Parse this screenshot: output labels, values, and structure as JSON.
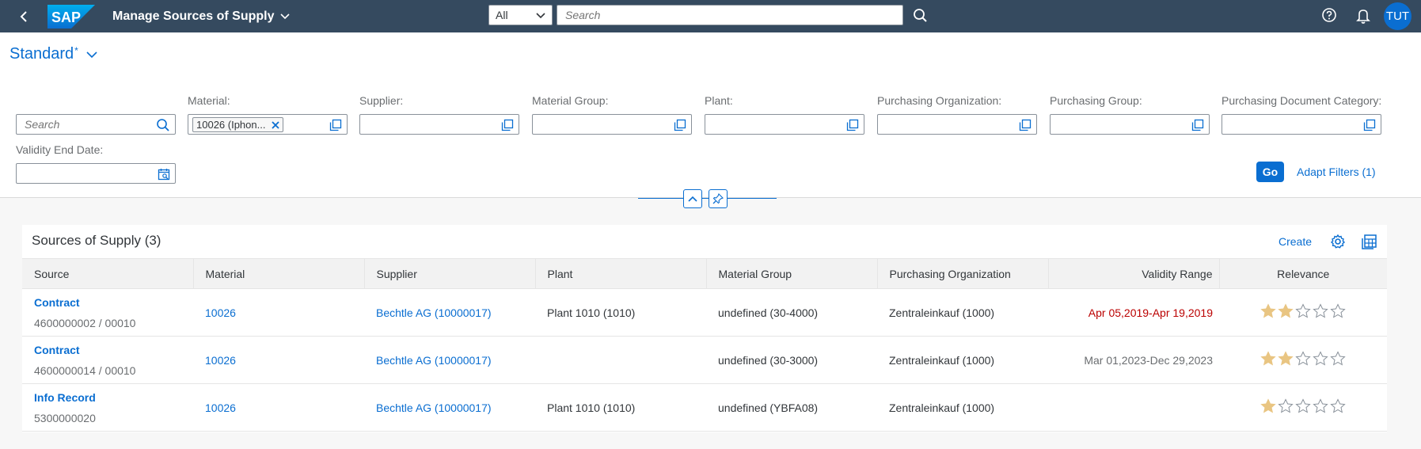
{
  "shell": {
    "app_title": "Manage Sources of Supply",
    "scope": "All",
    "search_placeholder": "Search",
    "avatar_initials": "TUT",
    "logo_text": "SAP"
  },
  "variant": {
    "name": "Standard",
    "modified_marker": "*"
  },
  "filters": {
    "search_placeholder": "Search",
    "material_label": "Material:",
    "material_token": "10026 (Iphon...",
    "supplier_label": "Supplier:",
    "material_group_label": "Material Group:",
    "plant_label": "Plant:",
    "purch_org_label": "Purchasing Organization:",
    "purch_group_label": "Purchasing Group:",
    "purch_doc_cat_label": "Purchasing Document Category:",
    "validity_end_label": "Validity End Date:",
    "go_label": "Go",
    "adapt_label": "Adapt Filters (1)"
  },
  "table": {
    "title": "Sources of Supply (3)",
    "create_label": "Create",
    "columns": [
      "Source",
      "Material",
      "Supplier",
      "Plant",
      "Material Group",
      "Purchasing Organization",
      "Validity Range",
      "Relevance"
    ],
    "rows": [
      {
        "source_type": "Contract",
        "source_number": "4600000002 / 00010",
        "material": "10026",
        "supplier": "Bechtle AG (10000017)",
        "plant": "Plant 1010 (1010)",
        "material_group": "undefined (30-4000)",
        "purch_org": "Zentraleinkauf (1000)",
        "validity": "Apr 05,2019-Apr 19,2019",
        "validity_status": "expired",
        "relevance": 2
      },
      {
        "source_type": "Contract",
        "source_number": "4600000014 / 00010",
        "material": "10026",
        "supplier": "Bechtle AG (10000017)",
        "plant": "",
        "material_group": "undefined (30-3000)",
        "purch_org": "Zentraleinkauf (1000)",
        "validity": "Mar 01,2023-Dec 29,2023",
        "validity_status": "normal",
        "relevance": 2
      },
      {
        "source_type": "Info Record",
        "source_number": "5300000020",
        "material": "10026",
        "supplier": "Bechtle AG (10000017)",
        "plant": "Plant 1010 (1010)",
        "material_group": "undefined (YBFA08)",
        "purch_org": "Zentraleinkauf (1000)",
        "validity": "",
        "validity_status": "normal",
        "relevance": 1
      }
    ],
    "relevance_max": 5
  },
  "colors": {
    "shell_bg": "#354a5f",
    "brand_blue": "#0a6ed1",
    "negative": "#bb0000",
    "star_filled": "#e9c582",
    "star_empty": "#89919a"
  }
}
